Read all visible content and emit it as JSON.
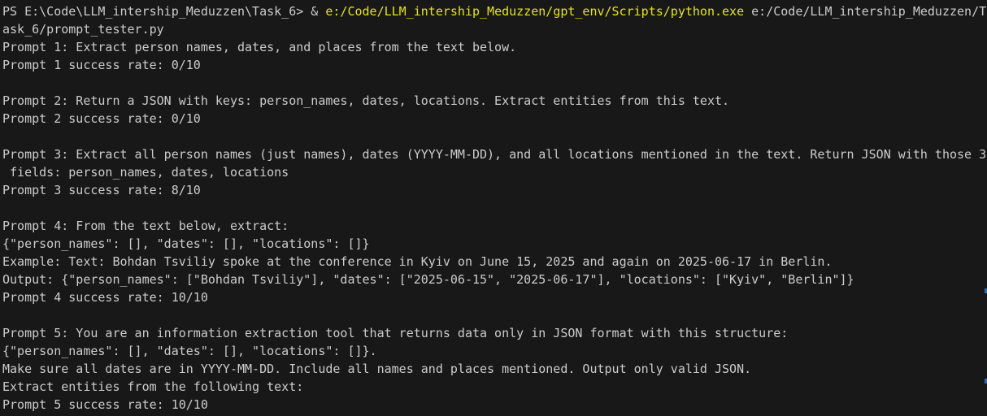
{
  "terminal": {
    "command": {
      "prompt": "PS E:\\Code\\LLM_intership_Meduzzen\\Task_6> ",
      "operator": "& ",
      "executable": "e:/Code/LLM_intership_Meduzzen/gpt_env/Scripts/python.exe",
      "argument_part1": " e:/Code/LLM_intership_Meduzzen/T",
      "argument_part2": "ask_6/prompt_tester.py"
    },
    "lines": [
      "Prompt 1: Extract person names, dates, and places from the text below.",
      "Prompt 1 success rate: 0/10",
      "",
      "Prompt 2: Return a JSON with keys: person_names, dates, locations. Extract entities from this text.",
      "Prompt 2 success rate: 0/10",
      "",
      "Prompt 3: Extract all person names (just names), dates (YYYY-MM-DD), and all locations mentioned in the text. Return JSON with those 3",
      " fields: person_names, dates, locations",
      "Prompt 3 success rate: 8/10",
      "",
      "Prompt 4: From the text below, extract:",
      "{\"person_names\": [], \"dates\": [], \"locations\": []}",
      "Example: Text: Bohdan Tsviliy spoke at the conference in Kyiv on June 15, 2025 and again on 2025-06-17 in Berlin.",
      "Output: {\"person_names\": [\"Bohdan Tsviliy\"], \"dates\": [\"2025-06-15\", \"2025-06-17\"], \"locations\": [\"Kyiv\", \"Berlin\"]}",
      "Prompt 4 success rate: 10/10",
      "",
      "Prompt 5: You are an information extraction tool that returns data only in JSON format with this structure:",
      "{\"person_names\": [], \"dates\": [], \"locations\": []}.",
      "Make sure all dates are in YYYY-MM-DD. Include all names and places mentioned. Output only valid JSON.",
      "Extract entities from the following text:",
      "Prompt 5 success rate: 10/10"
    ]
  }
}
